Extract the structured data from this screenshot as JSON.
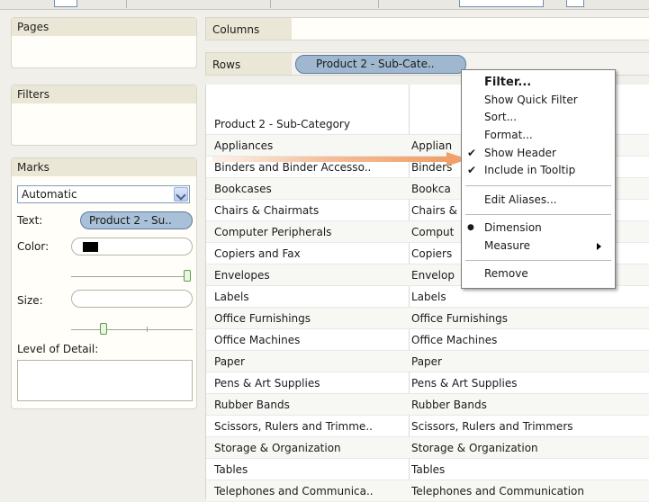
{
  "cards": {
    "pages": "Pages",
    "filters": "Filters",
    "marks": "Marks"
  },
  "marks": {
    "type": "Automatic",
    "text_label": "Text:",
    "text_field": "Product 2 - Su..",
    "color_label": "Color:",
    "size_label": "Size:",
    "lod_label": "Level of Detail:",
    "color_value": "#000000"
  },
  "shelves": {
    "columns": "Columns",
    "rows": "Rows",
    "rows_pill": "Product 2 - Sub-Cate.."
  },
  "table": {
    "header": "Product 2 - Sub-Category",
    "rows": [
      [
        "Appliances",
        "Applian"
      ],
      [
        "Binders and Binder Accesso..",
        "Binders"
      ],
      [
        "Bookcases",
        "Bookca"
      ],
      [
        "Chairs & Chairmats",
        "Chairs &"
      ],
      [
        "Computer Peripherals",
        "Comput"
      ],
      [
        "Copiers and Fax",
        "Copiers"
      ],
      [
        "Envelopes",
        "Envelop"
      ],
      [
        "Labels",
        "Labels"
      ],
      [
        "Office Furnishings",
        "Office Furnishings"
      ],
      [
        "Office Machines",
        "Office Machines"
      ],
      [
        "Paper",
        "Paper"
      ],
      [
        "Pens & Art Supplies",
        "Pens & Art Supplies"
      ],
      [
        "Rubber Bands",
        "Rubber Bands"
      ],
      [
        "Scissors, Rulers and Trimme..",
        "Scissors, Rulers and Trimmers"
      ],
      [
        "Storage & Organization",
        "Storage & Organization"
      ],
      [
        "Tables",
        "Tables"
      ],
      [
        "Telephones and Communica..",
        "Telephones and Communication"
      ]
    ]
  },
  "menu": {
    "filter": "Filter...",
    "show_quick_filter": "Show Quick Filter",
    "sort": "Sort...",
    "format": "Format...",
    "show_header": "Show Header",
    "include_in_tooltip": "Include in Tooltip",
    "edit_aliases": "Edit Aliases...",
    "dimension": "Dimension",
    "measure": "Measure",
    "remove": "Remove",
    "check_glyph": "✔",
    "bullet_glyph": "●"
  },
  "colors": {
    "drag_arrow": "#f0a06a",
    "pill": "#a9c1d8"
  }
}
